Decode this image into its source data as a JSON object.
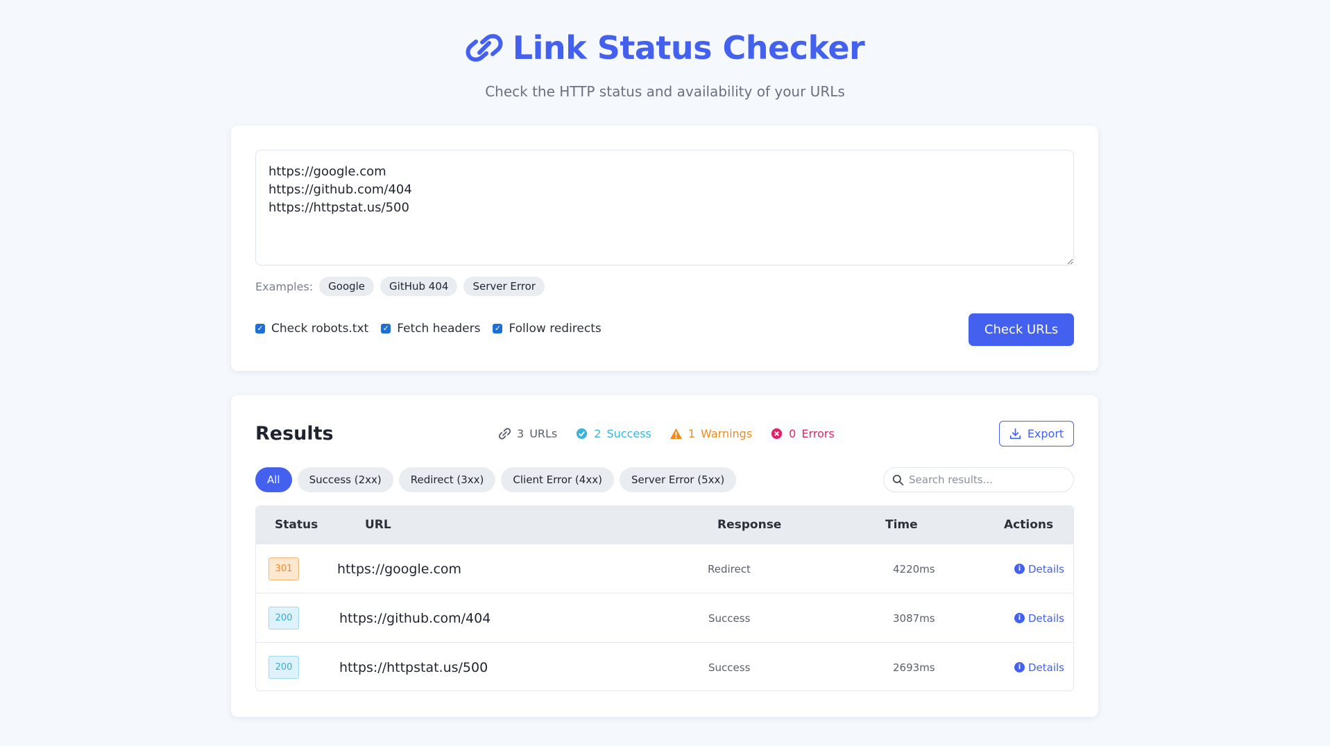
{
  "header": {
    "title": "Link Status Checker",
    "subtitle": "Check the HTTP status and availability of your URLs"
  },
  "input": {
    "urls_value": "https://google.com\nhttps://github.com/404\nhttps://httpstat.us/500",
    "examples_label": "Examples:",
    "examples": [
      "Google",
      "GitHub 404",
      "Server Error"
    ],
    "options": [
      {
        "label": "Check robots.txt",
        "checked": true
      },
      {
        "label": "Fetch headers",
        "checked": true
      },
      {
        "label": "Follow redirects",
        "checked": true
      }
    ],
    "check_button": "Check URLs"
  },
  "results": {
    "title": "Results",
    "stats": {
      "urls_count": "3",
      "urls_label": "URLs",
      "success_count": "2",
      "success_label": "Success",
      "warnings_count": "1",
      "warnings_label": "Warnings",
      "errors_count": "0",
      "errors_label": "Errors"
    },
    "export_label": "Export",
    "filters": [
      "All",
      "Success (2xx)",
      "Redirect (3xx)",
      "Client Error (4xx)",
      "Server Error (5xx)"
    ],
    "active_filter": "All",
    "search_placeholder": "Search results...",
    "columns": [
      "Status",
      "URL",
      "Response",
      "Time",
      "Actions"
    ],
    "rows": [
      {
        "status": "301",
        "url": "https://google.com",
        "response": "Redirect",
        "time": "4220ms",
        "action": "Details"
      },
      {
        "status": "200",
        "url": "https://github.com/404",
        "response": "Success",
        "time": "3087ms",
        "action": "Details"
      },
      {
        "status": "200",
        "url": "https://httpstat.us/500",
        "response": "Success",
        "time": "2693ms",
        "action": "Details"
      }
    ]
  },
  "colors": {
    "accent": "#4361ee",
    "success": "#3ab4dc",
    "warning": "#ef8a1b",
    "error": "#e0246a"
  },
  "icons": {
    "title": "link-icon",
    "urls": "link-icon",
    "success": "check-circle-icon",
    "warning": "warning-triangle-icon",
    "error": "x-circle-icon",
    "export": "download-icon",
    "search": "search-icon",
    "details": "info-icon"
  }
}
